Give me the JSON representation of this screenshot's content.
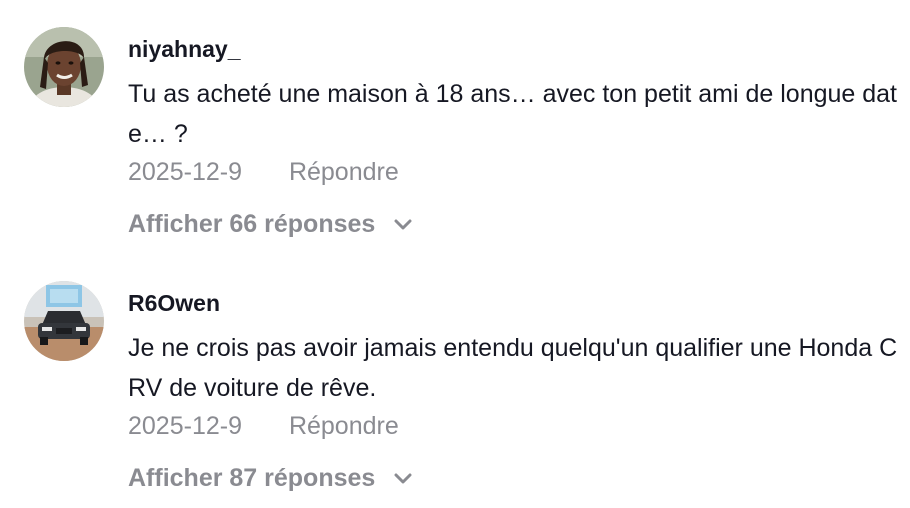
{
  "comments": [
    {
      "username": "niyahnay_",
      "text": "Tu as acheté une maison à 18 ans… avec ton petit ami de longue date… ?",
      "date": "2025-12-9",
      "reply_label": "Répondre",
      "replies_label": "Afficher 66 réponses",
      "avatar_icon": "person-avatar-icon"
    },
    {
      "username": "R6Owen",
      "text": "Je ne crois pas avoir jamais entendu quelqu'un qualifier une Honda CRV de voiture de rêve.",
      "date": "2025-12-9",
      "reply_label": "Répondre",
      "replies_label": "Afficher 87 réponses",
      "avatar_icon": "car-avatar-icon"
    }
  ],
  "colors": {
    "primary_text": "#161823",
    "secondary_text": "#8a8b91"
  }
}
